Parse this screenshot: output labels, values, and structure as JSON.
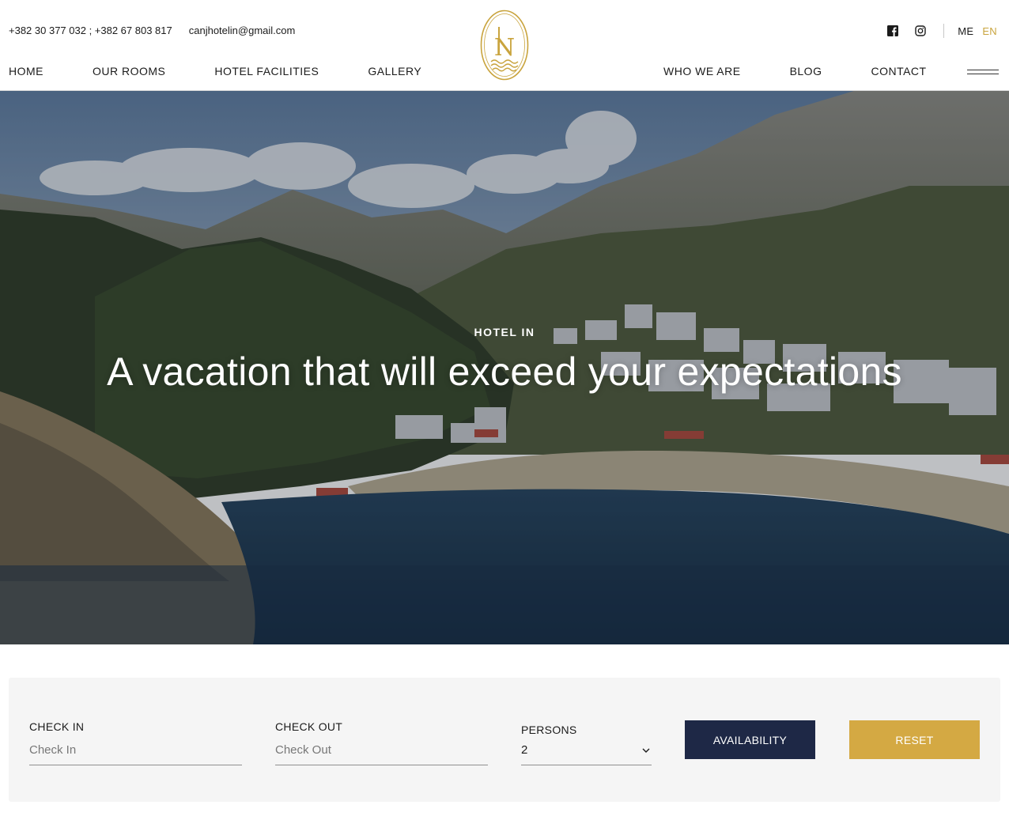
{
  "header": {
    "phones": "+382 30 377 032 ; +382 67 803 817",
    "email": "canjhotelin@gmail.com",
    "social": [
      "facebook-icon",
      "instagram-icon"
    ],
    "languages": [
      {
        "code": "ME",
        "active": false
      },
      {
        "code": "EN",
        "active": true
      }
    ],
    "logo": "hotel-in-logo",
    "nav_left": [
      "HOME",
      "OUR ROOMS",
      "HOTEL FACILITIES",
      "GALLERY"
    ],
    "nav_right": [
      "WHO WE ARE",
      "BLOG",
      "CONTACT"
    ],
    "menu_icon": "hamburger-icon"
  },
  "hero": {
    "subtitle": "HOTEL IN",
    "title": "A vacation that will exceed your expectations"
  },
  "booking": {
    "checkin_label": "CHECK IN",
    "checkin_placeholder": "Check In",
    "checkout_label": "CHECK OUT",
    "checkout_placeholder": "Check Out",
    "persons_label": "PERSONS",
    "persons_value": "2",
    "availability_label": "AVAILABILITY",
    "reset_label": "RESET"
  },
  "colors": {
    "accent_gold": "#c9a43e",
    "button_navy": "#1e2846",
    "button_gold": "#d4a943",
    "panel_bg": "#f5f5f5"
  }
}
